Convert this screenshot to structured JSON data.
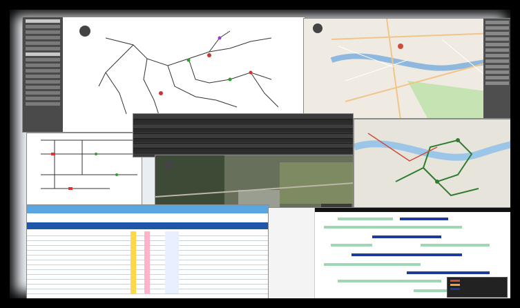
{
  "app": {
    "collage": "gis-dispatching-dashboard-collage"
  },
  "panels": {
    "network_map": {
      "side_rows": 18
    },
    "city_map": {},
    "timeline": {
      "labels": [
        "",
        "",
        "",
        ""
      ]
    },
    "grid": {
      "rows": 14
    },
    "satellite": {},
    "route_map": {},
    "table": {
      "title": "",
      "columns": [],
      "rows": 16
    },
    "gantt": {}
  },
  "colors": {
    "table_header": "#5aa6e0",
    "table_band": "#1e56a8",
    "gantt_green": "#9fd7b5",
    "gantt_blue": "#1f3a9e",
    "map_line": "#2f7d2f",
    "map_red": "#d14a3a"
  }
}
